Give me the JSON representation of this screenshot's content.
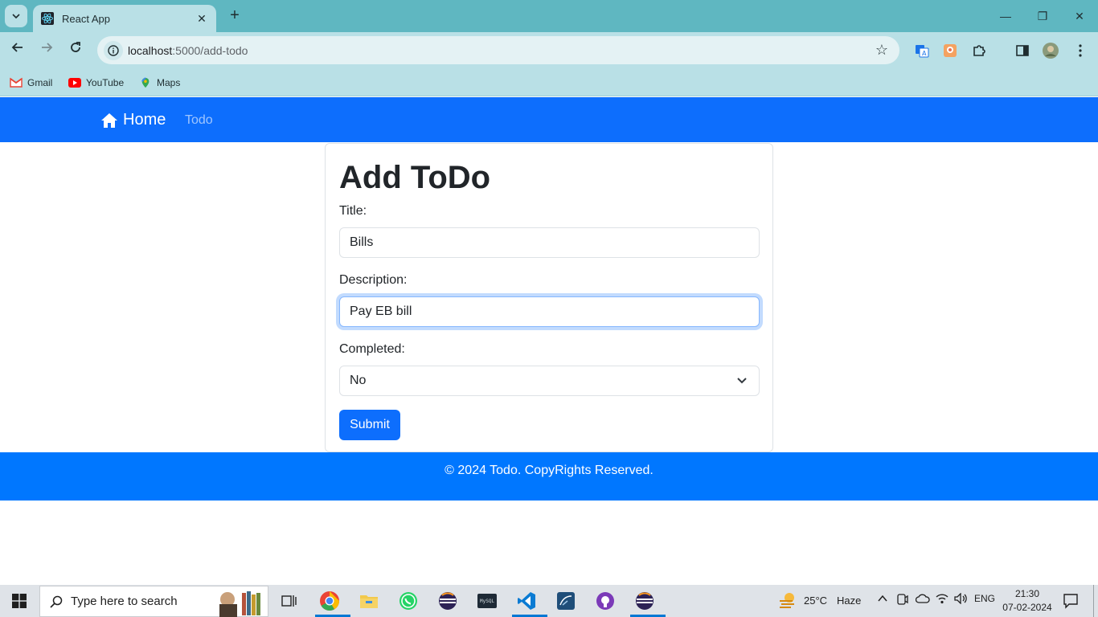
{
  "browser": {
    "tab_title": "React App",
    "url_host": "localhost",
    "url_path": ":5000/add-todo",
    "bookmarks": [
      {
        "label": "Gmail",
        "icon": "gmail-icon"
      },
      {
        "label": "YouTube",
        "icon": "youtube-icon"
      },
      {
        "label": "Maps",
        "icon": "maps-icon"
      }
    ]
  },
  "navbar": {
    "brand": "Home",
    "link_todo": "Todo",
    "color": "#0d6efd"
  },
  "form": {
    "heading": "Add ToDo",
    "title_label": "Title:",
    "title_value": "Bills",
    "description_label": "Description:",
    "description_value": "Pay EB bill",
    "completed_label": "Completed:",
    "completed_value": "No",
    "submit_label": "Submit"
  },
  "footer": {
    "text": "© 2024 Todo. CopyRights Reserved.",
    "color": "#0077ff"
  },
  "taskbar": {
    "search_placeholder": "Type here to search",
    "weather": "25°C",
    "weather_desc": "Haze",
    "language": "ENG",
    "time": "21:30",
    "date": "07-02-2024"
  }
}
